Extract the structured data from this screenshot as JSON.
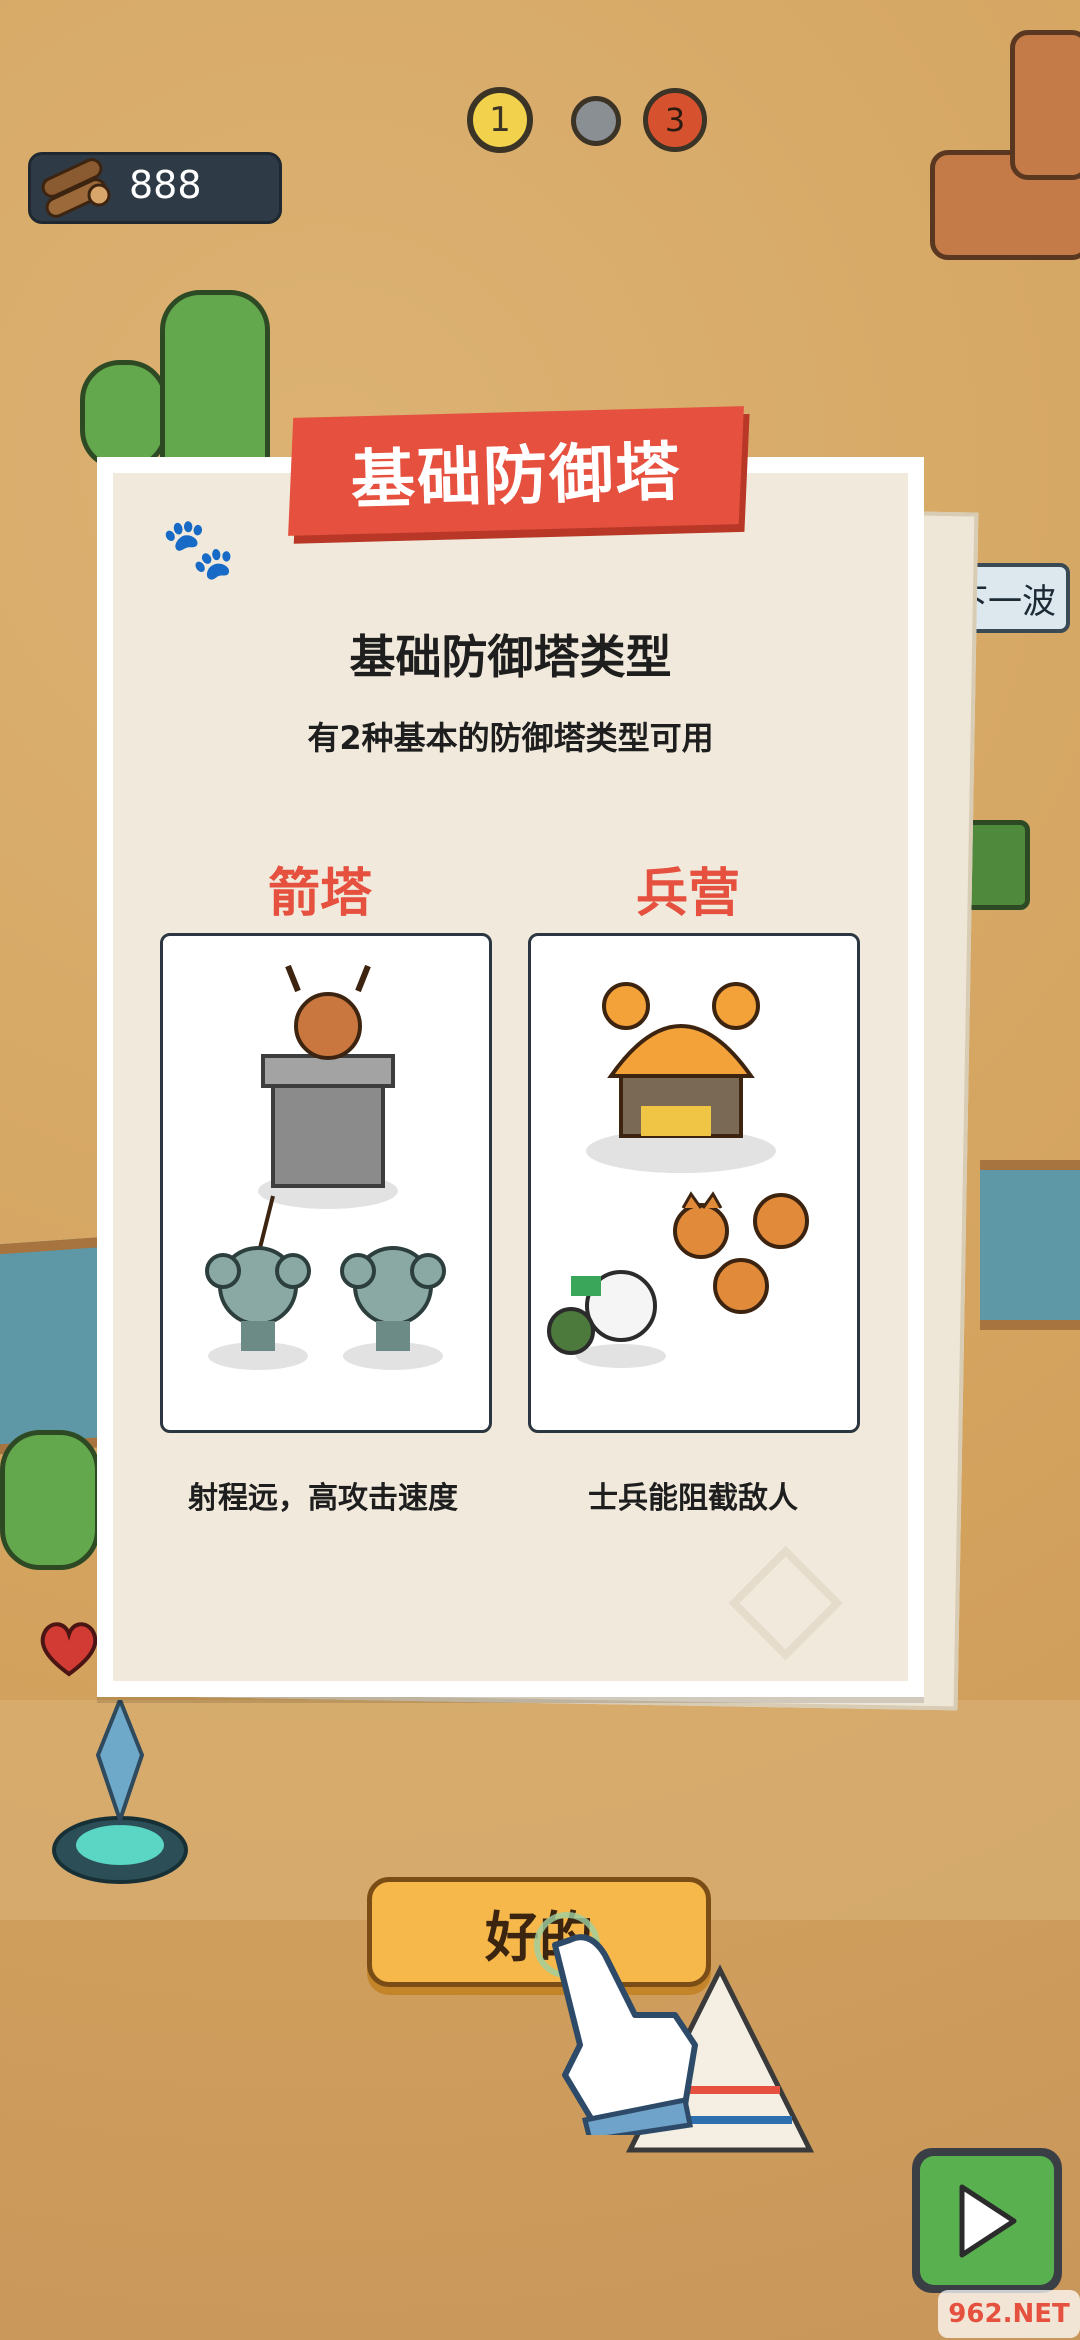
{
  "hud": {
    "wood_amount": "888",
    "wave_current": "1",
    "wave_boss": "3",
    "next_wave_label": "下一波"
  },
  "modal": {
    "banner_title": "基础防御塔",
    "title": "基础防御塔类型",
    "subtitle": "有2种基本的防御塔类型可用",
    "towers": [
      {
        "name": "箭塔",
        "description": "射程远，高攻击速度"
      },
      {
        "name": "兵营",
        "description": "士兵能阻截敌人"
      }
    ]
  },
  "ok_button": {
    "label": "好的"
  },
  "watermark": {
    "text": "962.NET"
  },
  "colors": {
    "accent_red": "#e5503f",
    "button_orange": "#f6b84b",
    "play_green": "#58b04f",
    "desert": "#d6a864"
  }
}
